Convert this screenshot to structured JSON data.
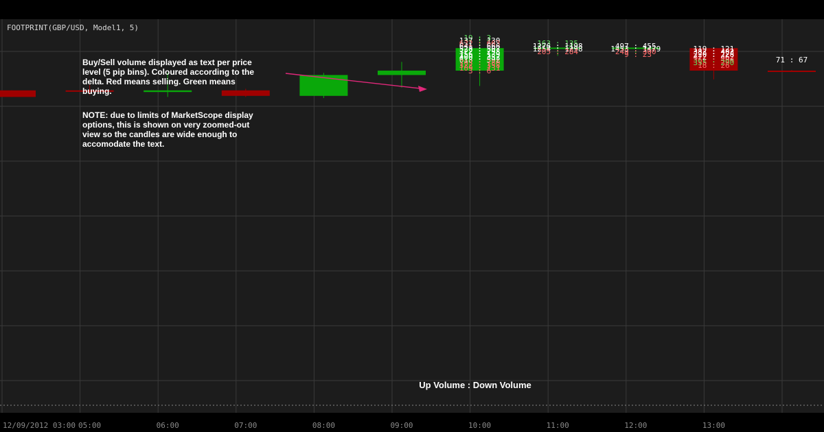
{
  "chart_data": {
    "type": "candlestick",
    "title": "FOOTPRINT(GBP/USD, Model1, 5)",
    "colors": {
      "up": "#0aa80a",
      "down": "#a00000",
      "background": "#1c1c1c",
      "grid": "#3a3a3a",
      "arrow": "#e0287a"
    },
    "x_ticks": [
      "12/09/2012 03:00",
      "05:00",
      "06:00",
      "07:00",
      "08:00",
      "09:00",
      "10:00",
      "11:00",
      "12:00",
      "13:00"
    ],
    "candles": [
      {
        "open": 1.6138,
        "close": 1.6126,
        "high": 1.6138,
        "low": 1.6126
      },
      {
        "open": 1.6138,
        "close": 1.6136,
        "high": 1.6148,
        "low": 1.613
      },
      {
        "open": 1.6135,
        "close": 1.6138,
        "high": 1.617,
        "low": 1.6126
      },
      {
        "open": 1.6138,
        "close": 1.6128,
        "high": 1.6141,
        "low": 1.6126
      },
      {
        "open": 1.6128,
        "close": 1.6166,
        "high": 1.617,
        "low": 1.6124
      },
      {
        "open": 1.6166,
        "close": 1.6174,
        "high": 1.619,
        "low": 1.6143
      },
      {
        "open": 1.6174,
        "close": 1.6215,
        "high": 1.6235,
        "low": 1.6146
      },
      {
        "open": 1.6215,
        "close": 1.6216,
        "high": 1.6218,
        "low": 1.6201
      },
      {
        "open": 1.6216,
        "close": 1.6216,
        "high": 1.6211,
        "low": 1.6204
      },
      {
        "open": 1.6215,
        "close": 1.6174,
        "high": 1.6215,
        "low": 1.6158
      },
      {
        "open": 1.6174,
        "close": 1.6173,
        "high": 1.6175,
        "low": 1.6173
      }
    ],
    "footprint": [
      {
        "candle": 6,
        "levels": [
          {
            "y": 1.6234,
            "text": "19 : 3",
            "tone": "buy"
          },
          {
            "y": 1.6229,
            "text": "137 : 130",
            "tone": "neutral"
          },
          {
            "y": 1.6224,
            "text": "632 : 663",
            "tone": "sell"
          },
          {
            "y": 1.6219,
            "text": "641 : 666",
            "tone": "neutral"
          },
          {
            "y": 1.6214,
            "text": "528 : 507",
            "tone": "neutral"
          },
          {
            "y": 1.6209,
            "text": "322 : 298",
            "tone": "neutral"
          },
          {
            "y": 1.6204,
            "text": "156 : 139",
            "tone": "neutral"
          },
          {
            "y": 1.6199,
            "text": "400 : 352",
            "tone": "neutral"
          },
          {
            "y": 1.6194,
            "text": "618 : 592",
            "tone": "neutral"
          },
          {
            "y": 1.6189,
            "text": "703 : 780",
            "tone": "sell"
          },
          {
            "y": 1.6184,
            "text": "322 : 358",
            "tone": "sell"
          },
          {
            "y": 1.6179,
            "text": "109 : 131",
            "tone": "sell"
          },
          {
            "y": 1.6174,
            "text": "3 : 6",
            "tone": "sell"
          }
        ]
      },
      {
        "candle": 7,
        "levels": [
          {
            "y": 1.6224,
            "text": "163 : 135",
            "tone": "buy"
          },
          {
            "y": 1.6219,
            "text": "1276 : 1198",
            "tone": "neutral"
          },
          {
            "y": 1.6214,
            "text": "1254 : 1298",
            "tone": "neutral"
          },
          {
            "y": 1.6209,
            "text": "205 : 284",
            "tone": "sell"
          }
        ]
      },
      {
        "candle": 8,
        "levels": [
          {
            "y": 1.6219,
            "text": "497 : 455",
            "tone": "neutral"
          },
          {
            "y": 1.6214,
            "text": "1453 : 1479",
            "tone": "neutral"
          },
          {
            "y": 1.6209,
            "text": "249 : 300",
            "tone": "sell"
          },
          {
            "y": 1.6204,
            "text": "9 : 23",
            "tone": "sell"
          }
        ]
      },
      {
        "candle": 9,
        "levels": [
          {
            "y": 1.6214,
            "text": "119 : 121",
            "tone": "neutral"
          },
          {
            "y": 1.6209,
            "text": "382 : 402",
            "tone": "neutral"
          },
          {
            "y": 1.6204,
            "text": "220 : 228",
            "tone": "neutral"
          },
          {
            "y": 1.6199,
            "text": "472 : 462",
            "tone": "neutral"
          },
          {
            "y": 1.6194,
            "text": "361 : 404",
            "tone": "sell"
          },
          {
            "y": 1.6189,
            "text": "355 : 290",
            "tone": "buy"
          },
          {
            "y": 1.6184,
            "text": "18 : 26",
            "tone": "sell"
          }
        ]
      },
      {
        "candle": 10,
        "levels": [
          {
            "y": 1.6194,
            "text": "71 : 67",
            "tone": "neutral"
          }
        ]
      }
    ],
    "annotations": {
      "description": [
        "Buy/Sell volume displayed as text per price",
        "level (5 pip bins). Coloured according to the",
        "delta. Red means selling. Green means",
        "buying."
      ],
      "note": [
        "NOTE: due to limits of MarketScope display",
        "options, this is shown on very zoomed-out",
        "view so the candles are wide enough to",
        "accomodate the text."
      ],
      "volume_label": "Up Volume : Down Volume"
    }
  }
}
